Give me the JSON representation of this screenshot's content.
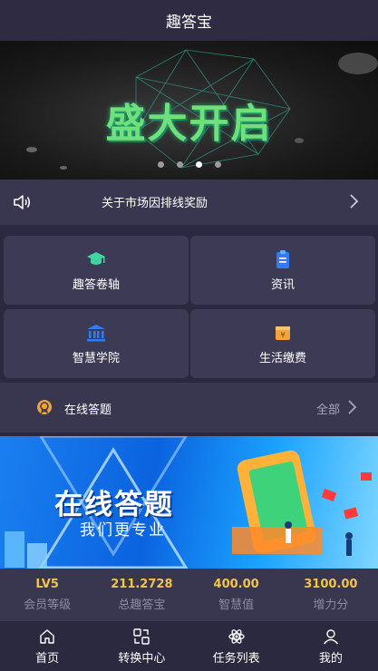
{
  "header": {
    "title": "趣答宝"
  },
  "banner": {
    "headline": "盛大开启",
    "dots": [
      false,
      false,
      true,
      false
    ]
  },
  "notice": {
    "text": "关于市场因排线奖励",
    "icon": "speaker-icon",
    "arrow": "chevron-right-icon"
  },
  "grid": [
    {
      "label": "趣答卷轴",
      "icon": "graduation-cap-icon",
      "color": "#3fd6a0"
    },
    {
      "label": "资讯",
      "icon": "clipboard-icon",
      "color": "#2f7cf6"
    },
    {
      "label": "智慧学院",
      "icon": "institution-icon",
      "color": "#2f7cf6"
    },
    {
      "label": "生活缴费",
      "icon": "wallet-icon",
      "color": "#f0a43a"
    }
  ],
  "quiz": {
    "label": "在线答题",
    "all_label": "全部",
    "icon": "medal-icon"
  },
  "promo": {
    "title": "在线答题",
    "subtitle": "我们更专业"
  },
  "stats": [
    {
      "value": "LV5",
      "caption": "会员等级"
    },
    {
      "value": "211.2728",
      "caption": "总趣答宝"
    },
    {
      "value": "400.00",
      "caption": "智慧值"
    },
    {
      "value": "3100.00",
      "caption": "增力分"
    }
  ],
  "tabs": [
    {
      "label": "首页",
      "icon": "home-icon"
    },
    {
      "label": "转换中心",
      "icon": "exchange-icon"
    },
    {
      "label": "任务列表",
      "icon": "atom-icon"
    },
    {
      "label": "我的",
      "icon": "user-icon"
    }
  ],
  "colors": {
    "accent": "#f3c448",
    "background": "#2b2940",
    "card": "#3d3a55"
  }
}
